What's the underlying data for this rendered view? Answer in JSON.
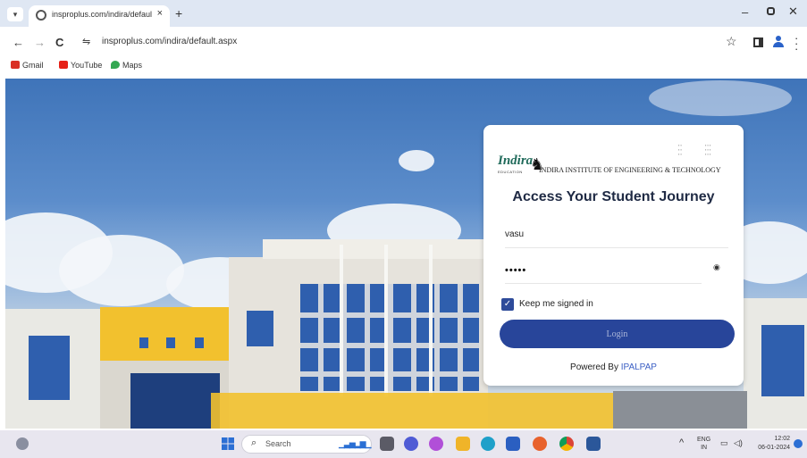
{
  "browser": {
    "tab_title": "insproplus.com/indira/default.",
    "tab_close": "×",
    "new_tab": "+",
    "url": "insproplus.com/indira/default.aspx",
    "nav": {
      "back": "←",
      "forward": "→",
      "reload": "C"
    },
    "bookmarks": [
      {
        "label": "Gmail",
        "icon": "gmail-icon",
        "color": "#d93025"
      },
      {
        "label": "YouTube",
        "icon": "youtube-icon",
        "color": "#e62117"
      },
      {
        "label": "Maps",
        "icon": "maps-icon",
        "color": "#34a853"
      }
    ]
  },
  "login": {
    "institute": "INDIRA INSTITUTE OF ENGINEERING & TECHNOLOGY",
    "logo_text": "Indira",
    "logo_sub": "EDUCATION",
    "heading": "Access Your Student Journey",
    "username_value": "vasu",
    "password_value": "•••••",
    "keep_signed_in": "Keep me signed in",
    "keep_checked": true,
    "login_button": "Login",
    "powered_by": "Powered By",
    "powered_brand": "IPALPAP"
  },
  "taskbar": {
    "search_label": "Search",
    "lang_top": "ENG",
    "lang_bottom": "IN",
    "time": "12:02",
    "date": "06-01-2024",
    "apps": [
      "file-explorer-icon",
      "teams-icon",
      "copilot-icon",
      "folder-icon",
      "edge-icon",
      "store-icon",
      "firefox-icon",
      "chrome-icon",
      "word-icon"
    ]
  },
  "colors": {
    "brand_button": "#28459a",
    "heading": "#1f2a44",
    "accent_link": "#3b5fc4"
  }
}
